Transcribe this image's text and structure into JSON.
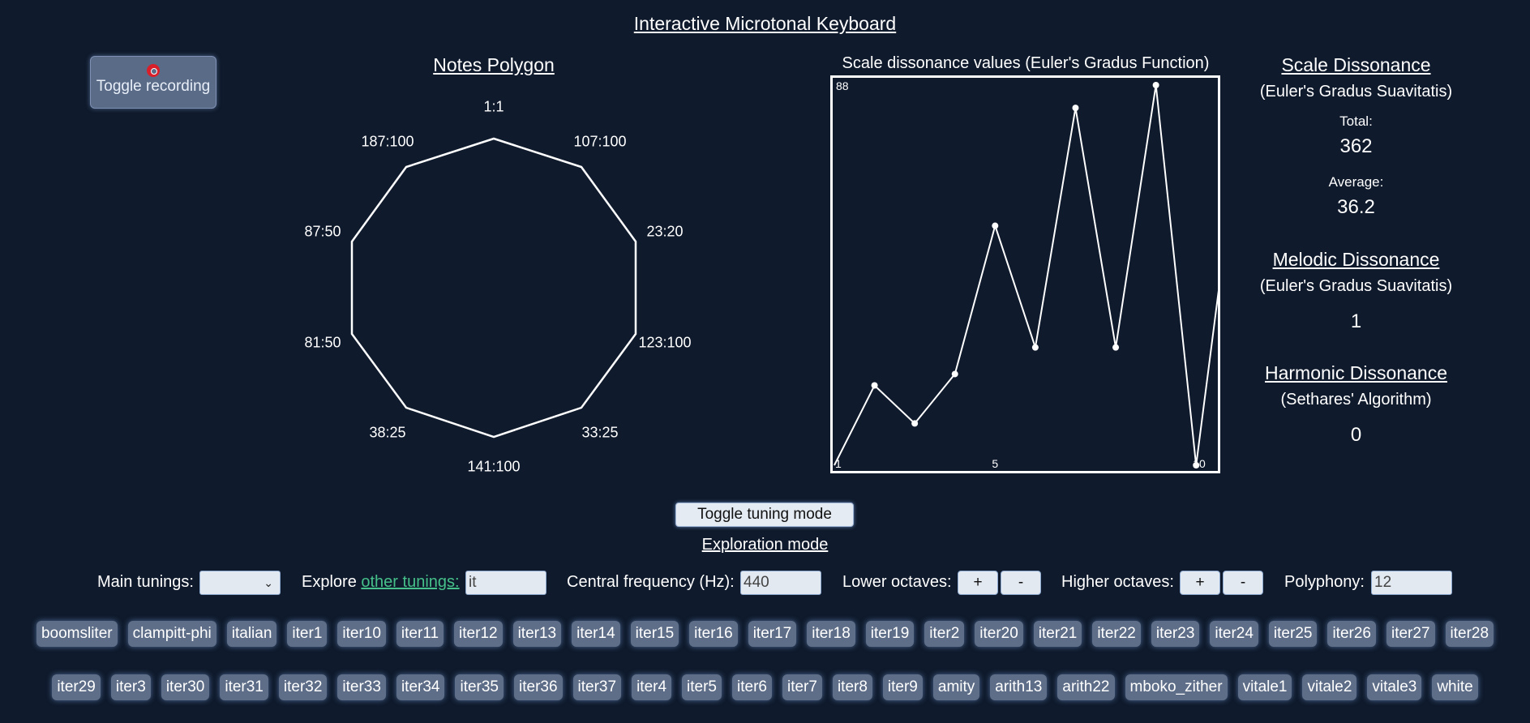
{
  "page_title": "Interactive Microtonal Keyboard",
  "record_button": {
    "label": "Toggle recording",
    "icon": "record-icon"
  },
  "polygon": {
    "title": "Notes Polygon",
    "labels": [
      "1:1",
      "107:100",
      "23:20",
      "123:100",
      "33:25",
      "141:100",
      "38:25",
      "81:50",
      "87:50",
      "187:100"
    ]
  },
  "chart_data": {
    "type": "line",
    "title": "Scale dissonance values (Euler's Gradus Function)",
    "x": [
      1,
      2,
      3,
      4,
      5,
      6,
      7,
      8,
      9,
      10,
      11
    ],
    "values": [
      0,
      21,
      11,
      24,
      63,
      31,
      94,
      31,
      100,
      0,
      46
    ],
    "ylim": [
      0,
      100
    ],
    "y_top_label": "88",
    "x_tick_labels": [
      "1",
      "5",
      "10"
    ],
    "line_color": "#ffffff"
  },
  "scale_dissonance": {
    "heading": "Scale Dissonance",
    "subtitle": "(Euler's Gradus Suavitatis)",
    "total_label": "Total:",
    "total_value": "362",
    "average_label": "Average:",
    "average_value": "36.2"
  },
  "melodic_dissonance": {
    "heading": "Melodic Dissonance",
    "subtitle": "(Euler's Gradus Suavitatis)",
    "value": "1"
  },
  "harmonic_dissonance": {
    "heading": "Harmonic Dissonance",
    "subtitle": "(Sethares' Algorithm)",
    "value": "0"
  },
  "tuning_mode_button": "Toggle tuning mode",
  "mode_label": "Exploration mode",
  "controls": {
    "main_tunings_label": "Main tunings:",
    "main_tunings_value": "",
    "explore_label": "Explore",
    "explore_link": "other tunings:",
    "explore_value": "it",
    "central_freq_label": "Central frequency (Hz):",
    "central_freq_value": "440",
    "lower_octaves_label": "Lower octaves:",
    "higher_octaves_label": "Higher octaves:",
    "plus": "+",
    "minus": "-",
    "polyphony_label": "Polyphony:",
    "polyphony_value": "12"
  },
  "tunings_row1": [
    "boomsliter",
    "clampitt-phi",
    "italian",
    "iter1",
    "iter10",
    "iter11",
    "iter12",
    "iter13",
    "iter14",
    "iter15",
    "iter16",
    "iter17",
    "iter18",
    "iter19",
    "iter2",
    "iter20",
    "iter21",
    "iter22",
    "iter23",
    "iter24",
    "iter25",
    "iter26",
    "iter27",
    "iter28"
  ],
  "tunings_row2": [
    "iter29",
    "iter3",
    "iter30",
    "iter31",
    "iter32",
    "iter33",
    "iter34",
    "iter35",
    "iter36",
    "iter37",
    "iter4",
    "iter5",
    "iter6",
    "iter7",
    "iter8",
    "iter9",
    "amity",
    "arith13",
    "arith22",
    "mboko_zither",
    "vitale1",
    "vitale2",
    "vitale3",
    "white"
  ]
}
